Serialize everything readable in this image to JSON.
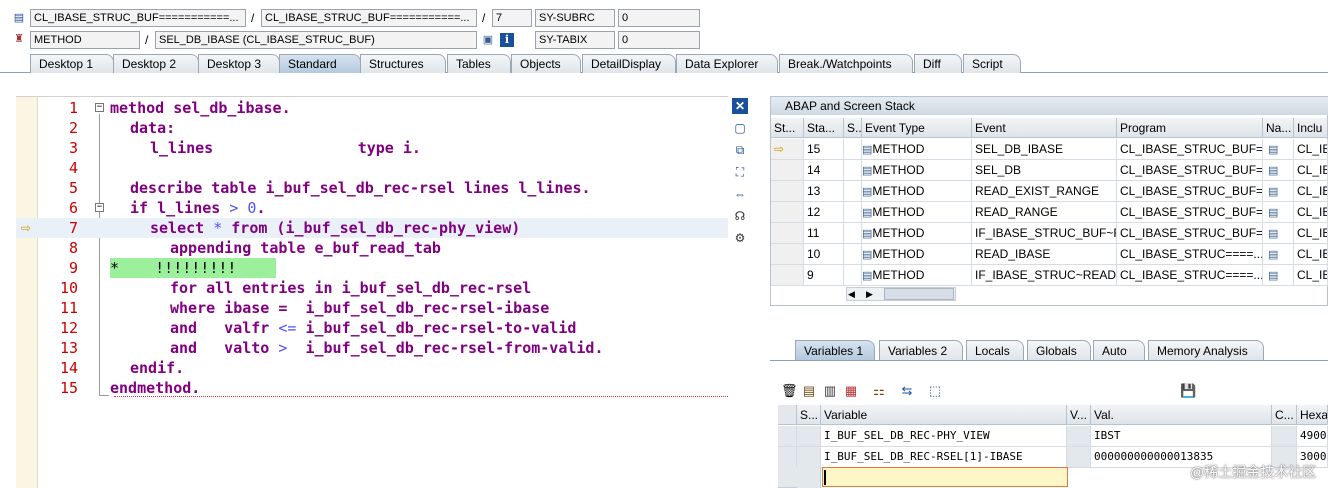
{
  "header": {
    "row1": {
      "program": "CL_IBASE_STRUC_BUF===========...",
      "include": "CL_IBASE_STRUC_BUF===========...",
      "line": "7",
      "var_name": "SY-SUBRC",
      "var_value": "0"
    },
    "row2": {
      "event_type": "METHOD",
      "event": "SEL_DB_IBASE (CL_IBASE_STRUC_BUF)",
      "var_name": "SY-TABIX",
      "var_value": "0"
    }
  },
  "tabs": [
    {
      "label": "Desktop 1"
    },
    {
      "label": "Desktop 2"
    },
    {
      "label": "Desktop 3"
    },
    {
      "label": "Standard"
    },
    {
      "label": "Structures"
    },
    {
      "label": "Tables"
    },
    {
      "label": "Objects"
    },
    {
      "label": "DetailDisplay"
    },
    {
      "label": "Data Explorer"
    },
    {
      "label": "Break./Watchpoints"
    },
    {
      "label": "Diff"
    },
    {
      "label": "Script"
    }
  ],
  "code": {
    "line_numbers": [
      "1",
      "2",
      "3",
      "4",
      "5",
      "6",
      "7",
      "8",
      "9",
      "10",
      "11",
      "12",
      "13",
      "14",
      "15"
    ],
    "l1a": "method",
    "l1b": " sel_db_ibase.",
    "l2a": "data",
    "l2b": ":",
    "l3a": "l_lines                ",
    "l3b": "type",
    "l3c": " i.",
    "l5a": "describe table",
    "l5b": " i_buf_sel_db_rec-rsel ",
    "l5c": "lines",
    "l5d": " l_lines.",
    "l6a": "if",
    "l6b": " l_lines ",
    "l6c": "> 0",
    "l6d": ".",
    "l7a": "select",
    "l7b": " * ",
    "l7c": "from",
    "l7d": " (i_buf_sel_db_rec-phy_view)",
    "l8a": "appending table",
    "l8b": " e_buf_read_tab",
    "l9": "*    !!!!!!!!!",
    "l10a": "for all entries in",
    "l10b": " i_buf_sel_db_rec-rsel",
    "l11a": "where",
    "l11b": " ibase =  i_buf_sel_db_rec-rsel-ibase",
    "l12a": "and",
    "l12b": "   valfr ",
    "l12c": "<=",
    "l12d": " i_buf_sel_db_rec-rsel-to-valid",
    "l13a": "and",
    "l13b": "   valto ",
    "l13c": ">",
    "l13d": "  i_buf_sel_db_rec-rsel-from-valid.",
    "l14a": "endif",
    "l14b": ".",
    "l15a": "endmethod",
    "l15b": "."
  },
  "stack": {
    "title": "ABAP and Screen Stack",
    "columns": [
      "St...",
      "Sta...",
      "S...",
      "Event Type",
      "Event",
      "Program",
      "Na...",
      "Inclu"
    ],
    "rows": [
      {
        "level": "15",
        "type": "METHOD",
        "event": "SEL_DB_IBASE",
        "program": "CL_IBASE_STRUC_BUF=...",
        "incl": "CL_IB"
      },
      {
        "level": "14",
        "type": "METHOD",
        "event": "SEL_DB",
        "program": "CL_IBASE_STRUC_BUF=...",
        "incl": "CL_IB"
      },
      {
        "level": "13",
        "type": "METHOD",
        "event": "READ_EXIST_RANGE",
        "program": "CL_IBASE_STRUC_BUF=...",
        "incl": "CL_IB"
      },
      {
        "level": "12",
        "type": "METHOD",
        "event": "READ_RANGE",
        "program": "CL_IBASE_STRUC_BUF=...",
        "incl": "CL_IB"
      },
      {
        "level": "11",
        "type": "METHOD",
        "event": "IF_IBASE_STRUC_BUF~R...",
        "program": "CL_IBASE_STRUC_BUF=...",
        "incl": "CL_IB"
      },
      {
        "level": "10",
        "type": "METHOD",
        "event": "READ_IBASE",
        "program": "CL_IBASE_STRUC====...",
        "incl": "CL_IB"
      },
      {
        "level": "9",
        "type": "METHOD",
        "event": "IF_IBASE_STRUC~READ...",
        "program": "CL_IBASE_STRUC====...",
        "incl": "CL_IB"
      }
    ]
  },
  "var_tabs": [
    {
      "label": "Variables 1"
    },
    {
      "label": "Variables 2"
    },
    {
      "label": "Locals"
    },
    {
      "label": "Globals"
    },
    {
      "label": "Auto"
    },
    {
      "label": "Memory Analysis"
    }
  ],
  "vars": {
    "columns": [
      "S...",
      "Variable",
      "V...",
      "Val.",
      "C...",
      "Hexa"
    ],
    "rows": [
      {
        "name": "I_BUF_SEL_DB_REC-PHY_VIEW",
        "value": "IBST",
        "hex": "4900"
      },
      {
        "name": "I_BUF_SEL_DB_REC-RSEL[1]-IBASE",
        "value": "000000000000013835",
        "hex": "3000"
      }
    ]
  },
  "watermark": "@稀土掘金技术社区",
  "colors": {
    "accent": "#b4c9de",
    "comment_bg": "#9cf09c",
    "keyword": "#800080",
    "line_no": "#cc0000"
  }
}
